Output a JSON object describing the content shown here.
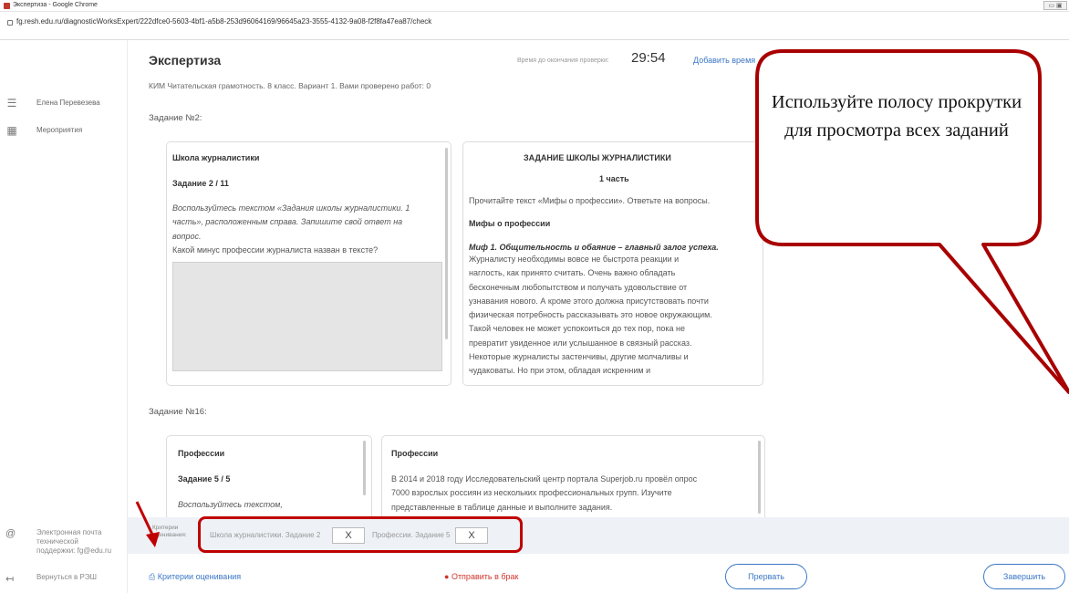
{
  "window": {
    "title": "Экспертиза - Google Chrome",
    "url": "fg.resh.edu.ru/diagnosticWorksExpert/222dfce0-5603-4bf1-a5b8-253d96064169/96645a23-3555-4132-9a08-f2f8fa47ea87/check"
  },
  "sidebar": {
    "items": [
      {
        "label": "Елена Перевезева",
        "icon": "menu-icon"
      },
      {
        "label": "Мероприятия",
        "icon": "calendar-icon"
      }
    ],
    "support": {
      "label": "Электронная почта\nтехнической\nподдержки: fg@edu.ru",
      "icon": "at-icon"
    },
    "back": {
      "label": "Вернуться в РЭШ",
      "icon": "logout-icon"
    }
  },
  "header": {
    "title": "Экспертиза",
    "timer_label": "Время до окончания проверки:",
    "timer": "29:54",
    "add_time": "Добавить время",
    "subtitle": "КИМ Читательская грамотность. 8 класс. Вариант 1. Вами проверено работ: 0"
  },
  "task1": {
    "heading": "Задание №2:",
    "left": {
      "title": "Школа журналистики",
      "number": "Задание 2 / 11",
      "instruction_lines": [
        "Воспользуйтесь текстом «Задания школы журналистики. 1",
        "часть», расположенным справа. Запишите свой ответ на",
        "вопрос."
      ],
      "question": "Какой минус профессии журналиста назван в тексте?"
    },
    "right": {
      "title": "ЗАДАНИЕ ШКОЛЫ ЖУРНАЛИСТИКИ",
      "part": "1 часть",
      "intro": "Прочитайте текст «Мифы о профессии». Ответьте на вопросы.",
      "subtitle": "Мифы о профессии",
      "myth": "Миф 1. Общительность и обаяние – главный залог успеха.",
      "body_lines": [
        "Журналисту необходимы вовсе не быстрота реакции и",
        "наглость, как принято считать. Очень важно обладать",
        "бесконечным любопытством и получать удовольствие от",
        "узнавания нового. А кроме этого должна присутствовать почти",
        "физическая потребность рассказывать это новое окружающим.",
        "Такой человек не может успокоиться до тех пор, пока не",
        "превратит увиденное или услышанное в связный рассказ.",
        "Некоторые журналисты застенчивы, другие молчаливы и",
        "чудаковаты. Но при этом, обладая искренним и"
      ]
    }
  },
  "task2": {
    "heading": "Задание №16:",
    "left": {
      "title": "Профессии",
      "number": "Задание 5 / 5",
      "instruction": "Воспользуйтесь текстом,"
    },
    "right": {
      "title": "Профессии",
      "body_lines": [
        "В 2014 и 2018 году Исследовательский центр портала Superjob.ru провёл опрос",
        "7000 взрослых россиян из нескольких профессиональных групп. Изучите",
        "представленные в таблице данные и выполните задания."
      ]
    }
  },
  "criteria": {
    "label": "Критерии\nоценивания:",
    "items": [
      {
        "label": "Школа журналистики. Задание 2",
        "value": "X"
      },
      {
        "label": "Профессии. Задание 5",
        "value": "X"
      }
    ]
  },
  "footer": {
    "criteria_link": "Критерии оценивания",
    "reject_link": "Отправить в брак",
    "interrupt": "Прервать",
    "finish": "Завершить"
  },
  "callout": {
    "text": "Используйте полосу прокрутки для просмотра всех заданий"
  },
  "colors": {
    "accent": "#3b77c5",
    "annotation": "#c00000",
    "reject": "#d0342c"
  }
}
